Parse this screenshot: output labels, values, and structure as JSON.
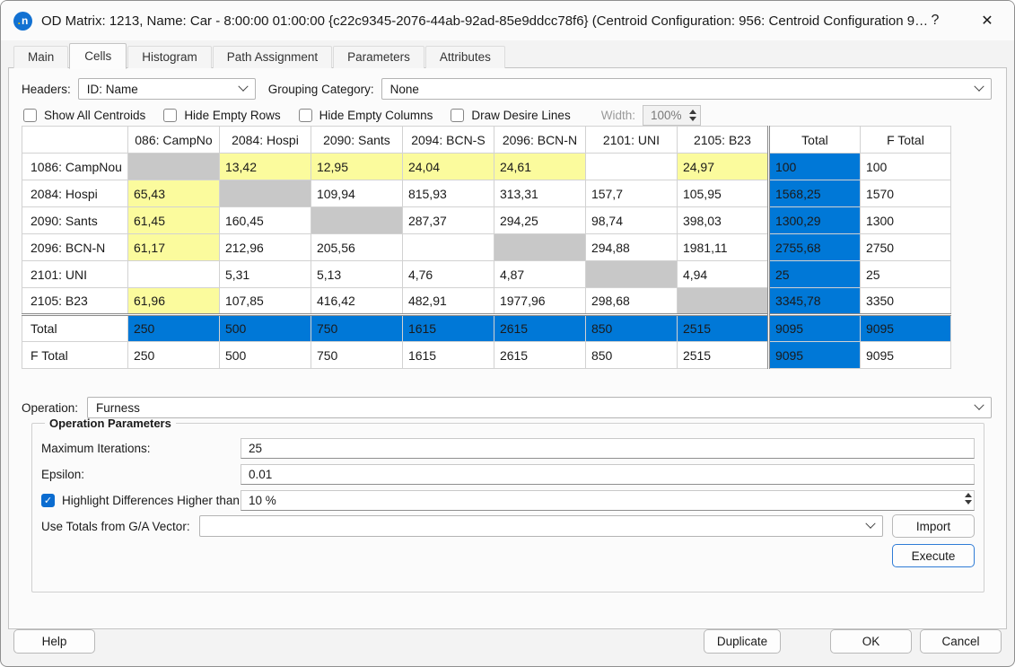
{
  "colors": {
    "accent_blue": "#0078d7",
    "cell_yellow": "#fbfb9d",
    "cell_gray": "#c8c8c8",
    "checkbox_blue": "#0b6cd0"
  },
  "window": {
    "title": "OD Matrix: 1213, Name: Car - 8:00:00 01:00:00  {c22c9345-2076-44ab-92ad-85e9ddcc78f6} (Centroid Configuration: 956: Centroid Configuration 9…",
    "help": "?",
    "close": "✕"
  },
  "tabs": {
    "items": [
      {
        "label": "Main",
        "active": false
      },
      {
        "label": "Cells",
        "active": true
      },
      {
        "label": "Histogram",
        "active": false
      },
      {
        "label": "Path Assignment",
        "active": false
      },
      {
        "label": "Parameters",
        "active": false
      },
      {
        "label": "Attributes",
        "active": false
      }
    ]
  },
  "controls": {
    "headers_label": "Headers:",
    "headers_value": "ID: Name",
    "grouping_label": "Grouping Category:",
    "grouping_value": "None",
    "checkboxes": [
      {
        "label": "Show All Centroids",
        "checked": false
      },
      {
        "label": "Hide Empty Rows",
        "checked": false
      },
      {
        "label": "Hide Empty Columns",
        "checked": false
      },
      {
        "label": "Draw Desire Lines",
        "checked": false
      }
    ],
    "width_label": "Width:",
    "width_value": "100%"
  },
  "matrix": {
    "columns": [
      "086: CampNo",
      "2084: Hospi",
      "2090: Sants",
      "2094: BCN-S",
      "2096: BCN-N",
      "2101: UNI",
      "2105: B23",
      "Total",
      "F Total"
    ],
    "rows": [
      {
        "label": "1086: CampNou",
        "cells": [
          {
            "v": "",
            "s": "g"
          },
          {
            "v": "13,42",
            "s": "y"
          },
          {
            "v": "12,95",
            "s": "y"
          },
          {
            "v": "24,04",
            "s": "y"
          },
          {
            "v": "24,61",
            "s": "y"
          },
          {
            "v": "",
            "s": "p"
          },
          {
            "v": "24,97",
            "s": "y"
          },
          {
            "v": "100",
            "s": "b"
          },
          {
            "v": "100",
            "s": "p"
          }
        ]
      },
      {
        "label": "2084: Hospi",
        "cells": [
          {
            "v": "65,43",
            "s": "y"
          },
          {
            "v": "",
            "s": "g"
          },
          {
            "v": "109,94",
            "s": "p"
          },
          {
            "v": "815,93",
            "s": "p"
          },
          {
            "v": "313,31",
            "s": "p"
          },
          {
            "v": "157,7",
            "s": "p"
          },
          {
            "v": "105,95",
            "s": "p"
          },
          {
            "v": "1568,25",
            "s": "b"
          },
          {
            "v": "1570",
            "s": "p"
          }
        ]
      },
      {
        "label": "2090: Sants",
        "cells": [
          {
            "v": "61,45",
            "s": "y"
          },
          {
            "v": "160,45",
            "s": "p"
          },
          {
            "v": "",
            "s": "g"
          },
          {
            "v": "287,37",
            "s": "p"
          },
          {
            "v": "294,25",
            "s": "p"
          },
          {
            "v": "98,74",
            "s": "p"
          },
          {
            "v": "398,03",
            "s": "p"
          },
          {
            "v": "1300,29",
            "s": "b"
          },
          {
            "v": "1300",
            "s": "p"
          }
        ]
      },
      {
        "label": "2096: BCN-N",
        "cells": [
          {
            "v": "61,17",
            "s": "y"
          },
          {
            "v": "212,96",
            "s": "p"
          },
          {
            "v": "205,56",
            "s": "p"
          },
          {
            "v": "",
            "s": "p"
          },
          {
            "v": "",
            "s": "g"
          },
          {
            "v": "294,88",
            "s": "p"
          },
          {
            "v": "1981,11",
            "s": "p"
          },
          {
            "v": "2755,68",
            "s": "b"
          },
          {
            "v": "2750",
            "s": "p"
          }
        ]
      },
      {
        "label": "2101: UNI",
        "cells": [
          {
            "v": "",
            "s": "p"
          },
          {
            "v": "5,31",
            "s": "p"
          },
          {
            "v": "5,13",
            "s": "p"
          },
          {
            "v": "4,76",
            "s": "p"
          },
          {
            "v": "4,87",
            "s": "p"
          },
          {
            "v": "",
            "s": "g"
          },
          {
            "v": "4,94",
            "s": "p"
          },
          {
            "v": "25",
            "s": "b"
          },
          {
            "v": "25",
            "s": "p"
          }
        ]
      },
      {
        "label": "2105: B23",
        "cells": [
          {
            "v": "61,96",
            "s": "y"
          },
          {
            "v": "107,85",
            "s": "p"
          },
          {
            "v": "416,42",
            "s": "p"
          },
          {
            "v": "482,91",
            "s": "p"
          },
          {
            "v": "1977,96",
            "s": "p"
          },
          {
            "v": "298,68",
            "s": "p"
          },
          {
            "v": "",
            "s": "g"
          },
          {
            "v": "3345,78",
            "s": "b"
          },
          {
            "v": "3350",
            "s": "p"
          }
        ]
      }
    ],
    "total_rows": [
      {
        "label": "Total",
        "cells": [
          {
            "v": "250",
            "s": "b"
          },
          {
            "v": "500",
            "s": "b"
          },
          {
            "v": "750",
            "s": "b"
          },
          {
            "v": "1615",
            "s": "b"
          },
          {
            "v": "2615",
            "s": "b"
          },
          {
            "v": "850",
            "s": "b"
          },
          {
            "v": "2515",
            "s": "b"
          },
          {
            "v": "9095",
            "s": "b"
          },
          {
            "v": "9095",
            "s": "b"
          }
        ]
      },
      {
        "label": "F Total",
        "cells": [
          {
            "v": "250",
            "s": "p"
          },
          {
            "v": "500",
            "s": "p"
          },
          {
            "v": "750",
            "s": "p"
          },
          {
            "v": "1615",
            "s": "p"
          },
          {
            "v": "2615",
            "s": "p"
          },
          {
            "v": "850",
            "s": "p"
          },
          {
            "v": "2515",
            "s": "p"
          },
          {
            "v": "9095",
            "s": "b"
          },
          {
            "v": "9095",
            "s": "p"
          }
        ]
      }
    ]
  },
  "operation": {
    "label": "Operation:",
    "value": "Furness"
  },
  "params": {
    "legend": "Operation Parameters",
    "max_iterations_label": "Maximum Iterations:",
    "max_iterations_value": "25",
    "epsilon_label": "Epsilon:",
    "epsilon_value": "0.01",
    "highlight": {
      "label": "Highlight Differences Higher than",
      "checked": true,
      "value": "10 %"
    },
    "ga_vector_label": "Use Totals from G/A Vector:",
    "ga_vector_value": "",
    "import_label": "Import",
    "execute_label": "Execute"
  },
  "footer": {
    "help": "Help",
    "duplicate": "Duplicate",
    "ok": "OK",
    "cancel": "Cancel"
  }
}
